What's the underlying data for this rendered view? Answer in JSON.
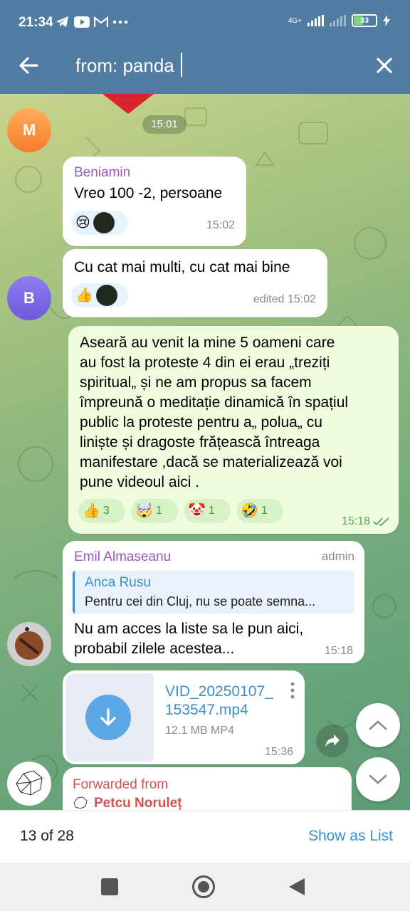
{
  "status_bar": {
    "time": "21:34",
    "network": "4G+",
    "battery": "33"
  },
  "header": {
    "search_query": "from: panda",
    "back_icon": "arrow-left-icon",
    "close_icon": "close-icon"
  },
  "chat": {
    "date_chip": "15:01",
    "avatars": {
      "m": "M",
      "b": "B"
    },
    "msg1": {
      "sender": "Beniamin",
      "text": "Vreo 100 -2, persoane",
      "time": "15:02",
      "reactions": [
        "😢"
      ]
    },
    "msg2": {
      "text": "Cu cat mai multi, cu cat mai bine",
      "time": "edited 15:02",
      "reactions": [
        "👍"
      ]
    },
    "msg3": {
      "lines": [
        "Aseară au venit la mine 5 oameni care",
        "au fost la proteste 4 din ei erau „treziți",
        "spiritual„ și ne am propus sa facem",
        "împreună o meditație dinamică în spațiul",
        "public la proteste pentru  a„ polua„ cu",
        "liniște și dragoste frățească întreaga",
        "manifestare ,dacă se materializează voi",
        "pune videoul aici ."
      ],
      "time": "15:18",
      "reactions": [
        {
          "emoji": "👍",
          "count": "3"
        },
        {
          "emoji": "🤯",
          "count": "1"
        },
        {
          "emoji": "🤡",
          "count": "1"
        },
        {
          "emoji": "🤣",
          "count": "1"
        }
      ]
    },
    "msg4": {
      "sender": "Emil Almaseanu",
      "role": "admin",
      "reply_name": "Anca Rusu",
      "reply_text": "Pentru cei din Cluj, nu se poate semna...",
      "line1": "Nu am acces la liste sa le pun aici,",
      "line2": "probabil zilele acestea...",
      "time": "15:18"
    },
    "msg5": {
      "file_name_1": "VID_20250107_",
      "file_name_2": "153547.mp4",
      "file_info": "12.1 MB MP4",
      "time": "15:36"
    },
    "msg6": {
      "forwarded_label": "Forwarded from",
      "forwarded_name": "Petcu Noruleț"
    }
  },
  "bottom": {
    "counter": "13 of 28",
    "show_as_list": "Show as List"
  },
  "colors": {
    "header": "#517da2",
    "accent": "#3a8fd1",
    "sender": "#9a5ab5"
  }
}
